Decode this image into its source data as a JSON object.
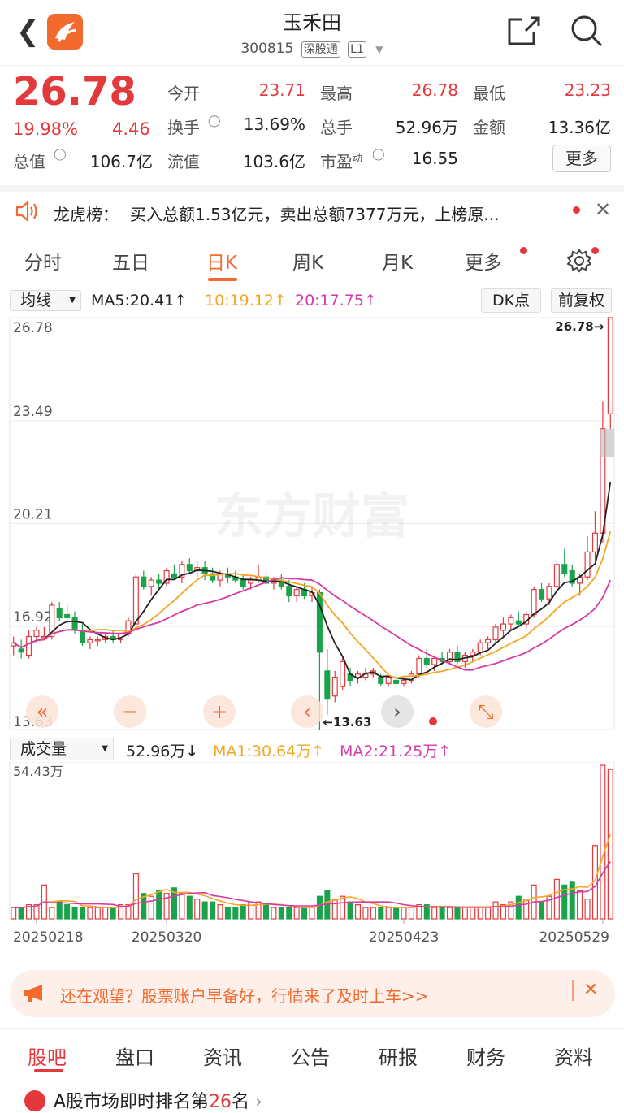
{
  "header": {
    "title": "玉禾田",
    "code": "300815",
    "tag1": "深股通",
    "tag2": "L1"
  },
  "quote": {
    "price": "26.78",
    "pct": "19.98%",
    "chg": "4.46",
    "open_label": "今开",
    "open": "23.71",
    "high_label": "最高",
    "high": "26.78",
    "low_label": "最低",
    "low": "23.23",
    "turnover_label": "换手",
    "turnover": "13.69%",
    "volume_label": "总手",
    "volume": "52.96万",
    "amount_label": "金额",
    "amount": "13.36亿",
    "mktcap_label": "总值",
    "mktcap": "106.7亿",
    "float_label": "流值",
    "float": "103.6亿",
    "pe_label": "市盈",
    "pe_sup": "动",
    "pe": "16.55",
    "more": "更多"
  },
  "lhb": {
    "label": "龙虎榜：",
    "text": "买入总额1.53亿元，卖出总额7377万元，上榜原..."
  },
  "tabs": [
    "分时",
    "五日",
    "日K",
    "周K",
    "月K",
    "更多"
  ],
  "ma": {
    "selector": "均线",
    "ma5": "MA5:20.41↑",
    "ma10": "10:19.12↑",
    "ma20": "20:17.75↑",
    "dk": "DK点",
    "adjust": "前复权"
  },
  "axis": {
    "y": [
      "26.78",
      "23.49",
      "20.21",
      "16.92",
      "13.63"
    ],
    "max_tag": "26.78",
    "min_tag": "13.63",
    "dates": [
      "20250218",
      "20250320",
      "20250423",
      "20250529"
    ],
    "watermark": "东方财富",
    "vol_top": "54.43万"
  },
  "vol": {
    "selector": "成交量",
    "value": "52.96万↓",
    "ma1": "MA1:30.64万↑",
    "ma2": "MA2:21.25万↑"
  },
  "colors": {
    "up": "#e4393c",
    "down": "#1aa34a",
    "ma5": "#222222",
    "ma10": "#f5a623",
    "ma20": "#d63aa6",
    "accent": "#f26a2d"
  },
  "promo": {
    "text": "还在观望？股票账户早备好，行情来了及时上车>>"
  },
  "bottom_tabs": [
    "股吧",
    "盘口",
    "资讯",
    "公告",
    "研报",
    "财务",
    "资料"
  ],
  "rank": {
    "prefix": "A股市场即时排名第",
    "num": "26",
    "suffix": "名"
  },
  "chart_data": {
    "type": "candlestick",
    "ylim": [
      13.63,
      26.78
    ],
    "ohlc": [
      [
        16.3,
        16.6,
        16.0,
        16.4
      ],
      [
        16.2,
        16.5,
        15.9,
        16.1
      ],
      [
        16.0,
        16.8,
        15.9,
        16.6
      ],
      [
        16.6,
        16.9,
        16.4,
        16.8
      ],
      [
        16.6,
        16.9,
        16.5,
        16.6
      ],
      [
        16.6,
        17.7,
        16.5,
        17.6
      ],
      [
        17.5,
        17.7,
        17.1,
        17.2
      ],
      [
        17.3,
        17.6,
        17.0,
        17.2
      ],
      [
        17.2,
        17.4,
        16.7,
        16.8
      ],
      [
        16.8,
        17.0,
        16.3,
        16.4
      ],
      [
        16.4,
        16.6,
        16.2,
        16.5
      ],
      [
        16.5,
        16.6,
        16.3,
        16.5
      ],
      [
        16.5,
        16.7,
        16.4,
        16.6
      ],
      [
        16.6,
        16.8,
        16.4,
        16.5
      ],
      [
        16.5,
        16.7,
        16.4,
        16.7
      ],
      [
        16.7,
        17.2,
        16.6,
        17.1
      ],
      [
        17.0,
        18.6,
        16.9,
        18.5
      ],
      [
        18.5,
        18.7,
        18.1,
        18.2
      ],
      [
        18.2,
        18.5,
        17.9,
        18.4
      ],
      [
        18.4,
        18.6,
        18.1,
        18.3
      ],
      [
        18.3,
        18.8,
        18.2,
        18.7
      ],
      [
        18.6,
        18.9,
        18.4,
        18.5
      ],
      [
        18.5,
        19.0,
        18.3,
        18.9
      ],
      [
        18.9,
        19.1,
        18.6,
        18.7
      ],
      [
        18.7,
        19.0,
        18.5,
        18.8
      ],
      [
        18.8,
        19.0,
        18.4,
        18.6
      ],
      [
        18.6,
        18.8,
        18.3,
        18.4
      ],
      [
        18.4,
        18.7,
        18.2,
        18.6
      ],
      [
        18.6,
        18.8,
        18.3,
        18.5
      ],
      [
        18.5,
        18.7,
        18.3,
        18.4
      ],
      [
        18.4,
        18.6,
        18.1,
        18.2
      ],
      [
        18.3,
        18.5,
        18.1,
        18.4
      ],
      [
        18.4,
        18.9,
        18.3,
        18.5
      ],
      [
        18.5,
        18.7,
        18.2,
        18.3
      ],
      [
        18.3,
        18.5,
        18.1,
        18.4
      ],
      [
        18.4,
        18.6,
        18.1,
        18.2
      ],
      [
        18.2,
        18.4,
        17.7,
        17.9
      ],
      [
        17.9,
        18.2,
        17.7,
        18.1
      ],
      [
        18.1,
        18.3,
        17.8,
        17.9
      ],
      [
        17.9,
        18.2,
        17.7,
        18.0
      ],
      [
        18.0,
        18.1,
        13.63,
        16.1
      ],
      [
        15.5,
        16.2,
        14.1,
        14.6
      ],
      [
        14.7,
        15.5,
        14.5,
        15.3
      ],
      [
        15.0,
        15.9,
        14.9,
        15.8
      ],
      [
        15.4,
        15.6,
        15.0,
        15.2
      ],
      [
        15.3,
        15.5,
        15.1,
        15.4
      ],
      [
        15.3,
        15.6,
        15.2,
        15.4
      ],
      [
        15.4,
        15.6,
        15.3,
        15.5
      ],
      [
        15.3,
        15.4,
        15.0,
        15.1
      ],
      [
        15.1,
        15.4,
        15.0,
        15.3
      ],
      [
        15.2,
        15.4,
        15.0,
        15.1
      ],
      [
        15.1,
        15.3,
        15.0,
        15.2
      ],
      [
        15.2,
        15.5,
        15.1,
        15.4
      ],
      [
        15.4,
        16.0,
        15.3,
        15.9
      ],
      [
        15.9,
        16.2,
        15.6,
        15.7
      ],
      [
        15.7,
        16.0,
        15.5,
        15.9
      ],
      [
        15.9,
        16.1,
        15.7,
        15.8
      ],
      [
        15.8,
        16.2,
        15.7,
        16.1
      ],
      [
        16.1,
        16.3,
        15.7,
        15.8
      ],
      [
        15.8,
        16.1,
        15.6,
        16.0
      ],
      [
        16.0,
        16.2,
        15.8,
        16.1
      ],
      [
        16.1,
        16.5,
        16.0,
        16.4
      ],
      [
        16.4,
        16.6,
        16.2,
        16.5
      ],
      [
        16.5,
        17.0,
        16.4,
        16.9
      ],
      [
        16.8,
        17.2,
        16.6,
        17.0
      ],
      [
        17.0,
        17.3,
        16.8,
        17.2
      ],
      [
        17.1,
        17.4,
        16.9,
        17.0
      ],
      [
        17.0,
        17.4,
        16.8,
        17.3
      ],
      [
        17.3,
        18.2,
        17.2,
        18.1
      ],
      [
        18.1,
        18.3,
        17.7,
        17.8
      ],
      [
        17.8,
        18.3,
        17.6,
        18.2
      ],
      [
        18.2,
        19.0,
        18.1,
        18.9
      ],
      [
        18.9,
        19.4,
        18.5,
        18.6
      ],
      [
        18.7,
        18.9,
        18.2,
        18.3
      ],
      [
        18.3,
        18.6,
        17.9,
        18.5
      ],
      [
        18.5,
        19.8,
        18.4,
        19.3
      ],
      [
        19.3,
        20.6,
        19.0,
        19.9
      ],
      [
        19.9,
        24.1,
        19.6,
        23.23
      ],
      [
        23.71,
        26.78,
        23.23,
        26.78
      ]
    ],
    "volume_max": "54.43万",
    "volume": [
      4,
      4,
      5,
      5,
      12,
      4,
      6,
      5,
      4,
      4,
      4,
      4,
      4,
      4,
      5,
      5,
      16,
      9,
      8,
      10,
      9,
      11,
      9,
      8,
      7,
      6,
      6,
      5,
      4,
      4,
      5,
      6,
      6,
      5,
      4,
      4,
      4,
      4,
      4,
      4,
      8,
      10,
      7,
      8,
      6,
      5,
      4,
      4,
      4,
      4,
      4,
      4,
      4,
      5,
      5,
      4,
      4,
      4,
      4,
      4,
      4,
      4,
      4,
      6,
      5,
      6,
      8,
      7,
      12,
      6,
      8,
      14,
      12,
      13,
      10,
      7,
      26,
      54.43,
      52.96
    ],
    "x_labels": [
      "20250218",
      "20250320",
      "20250423",
      "20250529"
    ]
  }
}
